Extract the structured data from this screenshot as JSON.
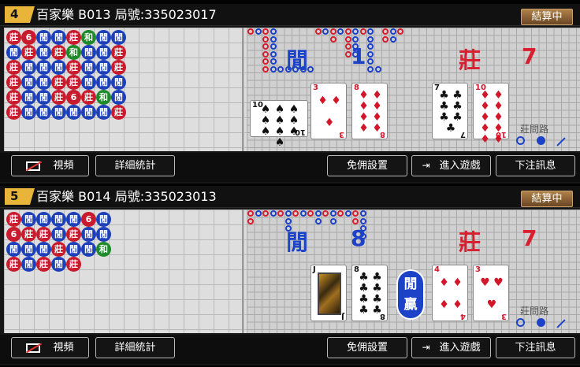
{
  "tables": [
    {
      "number": "4",
      "title": "百家樂 B013 局號:335023017",
      "status": "結算中",
      "player_label": "閒",
      "player_score": "1",
      "banker_label": "莊",
      "banker_score": "7",
      "winner_badge": "",
      "player_cards": [
        {
          "rank": "10",
          "suit": "♠",
          "color": "black",
          "sideways": true
        },
        {
          "rank": "3",
          "suit": "♦",
          "color": "red"
        },
        {
          "rank": "8",
          "suit": "♦",
          "color": "red"
        }
      ],
      "banker_cards": [
        {
          "rank": "7",
          "suit": "♣",
          "color": "black"
        },
        {
          "rank": "10",
          "suit": "♦",
          "color": "red"
        }
      ],
      "road_label": "莊問路",
      "beads": [
        [
          "N",
          "P",
          "B",
          "B",
          "B",
          "B"
        ],
        [
          "6",
          "B",
          "P",
          "P",
          "P",
          "P"
        ],
        [
          "P",
          "P",
          "P",
          "P",
          "P",
          "P"
        ],
        [
          "P",
          "B",
          "P",
          "B",
          "B",
          "P"
        ],
        [
          "B",
          "T",
          "B",
          "B",
          "6",
          "P"
        ],
        [
          "T",
          "P",
          "P",
          "P",
          "B",
          "P"
        ],
        [
          "P",
          "P",
          "P",
          "P",
          "T",
          "P"
        ],
        [
          "P",
          "B",
          "B",
          "P",
          "P",
          "B"
        ]
      ],
      "bead_text": {
        "P": "閒",
        "B": "莊",
        "T": "和",
        "6": "6",
        "N": "莊"
      },
      "buttons": {
        "video": "視頻",
        "stats": "詳細統計",
        "commission": "免佣設置",
        "enter": "進入遊戲",
        "bet_info": "下注訊息"
      }
    },
    {
      "number": "5",
      "title": "百家樂 B014 局號:335023013",
      "status": "結算中",
      "player_label": "閒",
      "player_score": "8",
      "banker_label": "莊",
      "banker_score": "7",
      "winner_badge": "閒贏",
      "player_cards": [
        {
          "rank": "J",
          "suit": "♣",
          "color": "black",
          "face": true
        },
        {
          "rank": "8",
          "suit": "♣",
          "color": "black"
        }
      ],
      "banker_cards": [
        {
          "rank": "4",
          "suit": "♦",
          "color": "red"
        },
        {
          "rank": "3",
          "suit": "♥",
          "color": "red"
        }
      ],
      "road_label": "莊問路",
      "beads": [
        [
          "B",
          "6",
          "P",
          "B"
        ],
        [
          "P",
          "B",
          "P",
          "P"
        ],
        [
          "P",
          "B",
          "P",
          "B"
        ],
        [
          "P",
          "P",
          "B",
          "P"
        ],
        [
          "P",
          "B",
          "P",
          "B"
        ],
        [
          "6",
          "P",
          "P",
          ""
        ],
        [
          "P",
          "P",
          "T",
          ""
        ]
      ],
      "bead_text": {
        "P": "閒",
        "B": "莊",
        "T": "和",
        "6": "6",
        "N": "莊"
      },
      "buttons": {
        "video": "視頻",
        "stats": "詳細統計",
        "commission": "免佣設置",
        "enter": "進入遊戲",
        "bet_info": "下注訊息"
      }
    }
  ],
  "colors": {
    "player": "#1d42c8",
    "banker": "#d81f2f",
    "tie": "#1e8a2a",
    "accent": "#e8b53a"
  }
}
